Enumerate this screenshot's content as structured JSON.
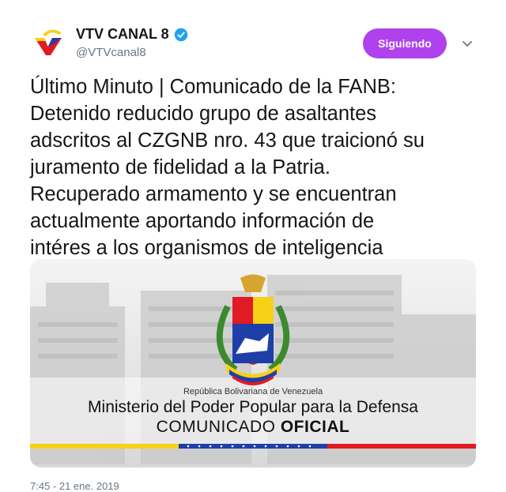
{
  "account": {
    "name": "VTV CANAL 8",
    "handle": "@VTVcanal8",
    "verified_icon": "verified-badge-icon",
    "logo_icon": "vtv-logo-icon"
  },
  "follow_button": {
    "label": "Siguiendo",
    "color": "#b042ee"
  },
  "menu_icon": "chevron-down-icon",
  "tweet": {
    "text": "Último Minuto | Comunicado de la FANB:\nDetenido reducido grupo de asaltantes\nadscritos al CZGNB nro. 43 que traicionó su\njuramento de fidelidad a la Patria.\nRecuperado armamento y se encuentran\nactualmente aportando información de\nintéres a los organismos de inteligencia"
  },
  "image": {
    "republic": "República Bolivariana de Venezuela",
    "ministry": "Ministerio del Poder Popular para la Defensa",
    "comunicado_prefix": "COMUNICADO",
    "comunicado_bold": "OFICIAL",
    "flag_colors": [
      "#f7d117",
      "#1e3fa8",
      "#e21a23"
    ]
  },
  "timestamp": "7:45 - 21 ene. 2019"
}
